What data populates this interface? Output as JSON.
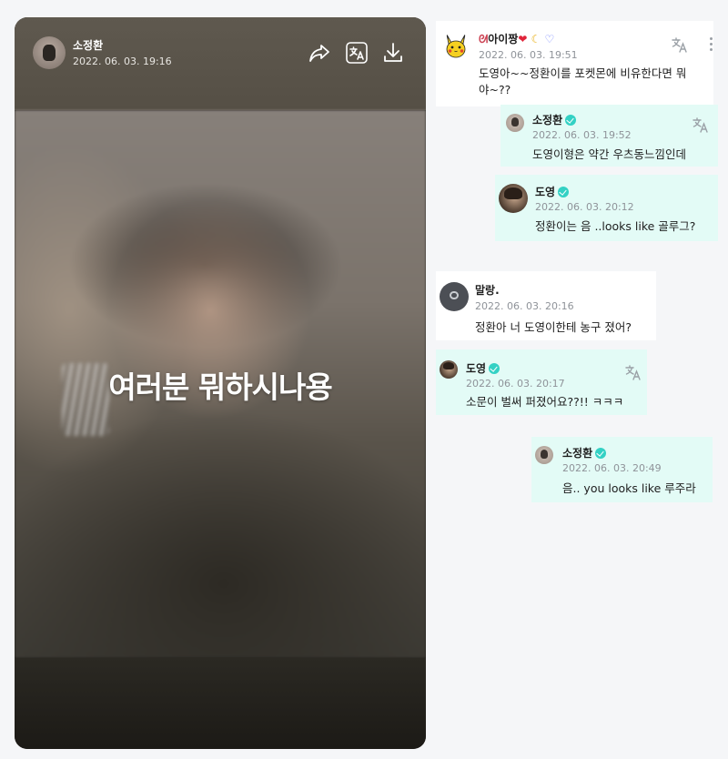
{
  "post": {
    "author": "소정환",
    "timestamp": "2022. 06. 03. 19:16",
    "caption": "여러분 뭐하시나용",
    "icons": [
      "share-icon",
      "translate-icon",
      "download-icon"
    ]
  },
  "comments": [
    {
      "author": "아이짱",
      "author_decor": [
        "rabbit-emoji",
        "heart-emoji",
        "moon-emoji",
        "heart-outline-icon"
      ],
      "timestamp": "2022. 06. 03. 19:51",
      "text": "도영아~~정환이를 포켓몬에 비유한다면 뭐야~??",
      "text_line1": "도영아~~정환이를 포켓몬에 비유한다면 뭐",
      "text_line2": "야~??",
      "style": "white"
    },
    {
      "author": "소정환",
      "verified": true,
      "timestamp": "2022. 06. 03. 19:52",
      "text": "도영이형은 약간 우츠동느낌인데",
      "style": "mint"
    },
    {
      "author": "도영",
      "verified": true,
      "timestamp": "2022. 06. 03. 20:12",
      "text": "정환이는 음 ..looks like 골루그?",
      "style": "mint"
    },
    {
      "author": "말랑.",
      "timestamp": "2022. 06. 03. 20:16",
      "text": "정환아 너 도영이한테 농구 졌어?",
      "style": "white"
    },
    {
      "author": "도영",
      "verified": true,
      "timestamp": "2022. 06. 03. 20:17",
      "text": "소문이 벌써 퍼졌어요??!! ㅋㅋㅋ",
      "style": "mint"
    },
    {
      "author": "소정환",
      "verified": true,
      "timestamp": "2022. 06. 03. 20:49",
      "text": "음.. you looks like 루주라",
      "style": "mint"
    }
  ],
  "colors": {
    "background": "#f5f6f8",
    "mint_bubble": "#e3fbf6",
    "verified_badge": "#33d1c4",
    "timestamp": "#8f9399"
  }
}
